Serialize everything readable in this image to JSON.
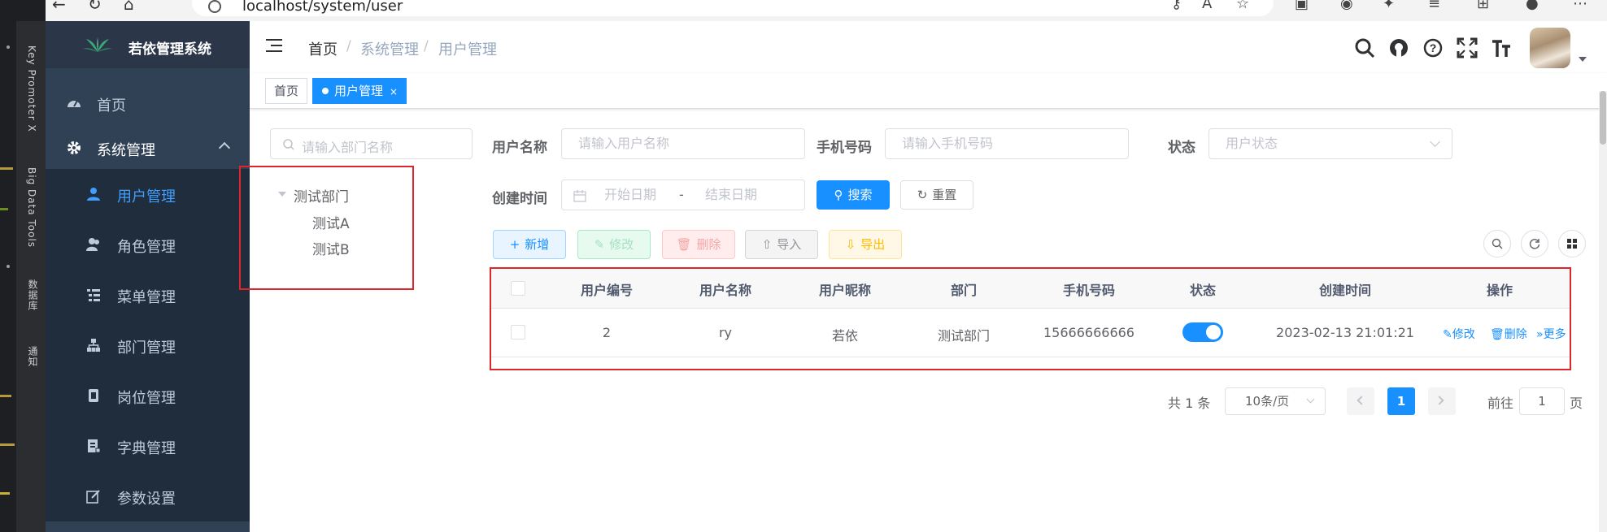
{
  "browser": {
    "url": "localhost/system/user"
  },
  "ide": {
    "panels": [
      "Key Promoter X",
      "Big Data Tools",
      "数据库",
      "通知"
    ]
  },
  "app": {
    "title": "若依管理系统"
  },
  "sidebar": {
    "items": [
      {
        "label": "首页",
        "icon": "dashboard-icon"
      },
      {
        "label": "系统管理",
        "icon": "gear-icon"
      },
      {
        "label": "用户管理",
        "icon": "user-icon",
        "active": true
      },
      {
        "label": "角色管理",
        "icon": "peoples-icon"
      },
      {
        "label": "菜单管理",
        "icon": "tree-table-icon"
      },
      {
        "label": "部门管理",
        "icon": "tree-icon"
      },
      {
        "label": "岗位管理",
        "icon": "post-icon"
      },
      {
        "label": "字典管理",
        "icon": "dict-icon"
      },
      {
        "label": "参数设置",
        "icon": "edit-icon"
      }
    ]
  },
  "breadcrumb": {
    "items": [
      "首页",
      "系统管理",
      "用户管理"
    ]
  },
  "tags": {
    "home": "首页",
    "active": "用户管理",
    "close": "×"
  },
  "dept": {
    "search_placeholder": "请输入部门名称",
    "tree": {
      "root": "测试部门",
      "children": [
        "测试A",
        "测试B"
      ]
    }
  },
  "search_form": {
    "username_label": "用户名称",
    "username_placeholder": "请输入用户名称",
    "phone_label": "手机号码",
    "phone_placeholder": "请输入手机号码",
    "status_label": "状态",
    "status_placeholder": "用户状态",
    "time_label": "创建时间",
    "start_placeholder": "开始日期",
    "range_sep": "-",
    "end_placeholder": "结束日期",
    "search_button": "搜索",
    "reset_button": "重置"
  },
  "toolbar": {
    "add": "新增",
    "edit": "修改",
    "delete": "删除",
    "import": "导入",
    "export": "导出"
  },
  "table": {
    "headers": [
      "用户编号",
      "用户名称",
      "用户昵称",
      "部门",
      "手机号码",
      "状态",
      "创建时间",
      "操作"
    ],
    "rows": [
      {
        "id": "2",
        "username": "ry",
        "nickname": "若依",
        "dept": "测试部门",
        "phone": "15666666666",
        "status_on": true,
        "created": "2023-02-13 21:01:21",
        "ops": [
          "修改",
          "删除",
          "更多"
        ]
      }
    ]
  },
  "pagination": {
    "total": "共 1 条",
    "page_size": "10条/页",
    "current": "1",
    "goto_label": "前往",
    "goto_value": "1",
    "page_suffix": "页"
  },
  "colors": {
    "primary": "#1890ff",
    "sidebar_bg": "#304156",
    "highlight_box": "#e0242b"
  }
}
